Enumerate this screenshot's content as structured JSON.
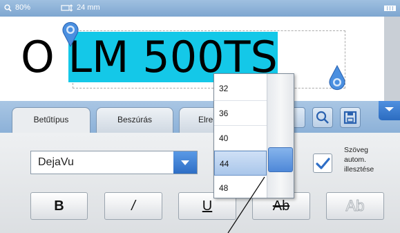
{
  "status": {
    "zoom": "80%",
    "tape_width": "24 mm"
  },
  "label": {
    "text_before": "O ",
    "text_selected": "LM 500TS"
  },
  "tabs": [
    {
      "label": "Betűtípus"
    },
    {
      "label": "Beszúrás"
    },
    {
      "label": "Elre"
    }
  ],
  "font": {
    "selected": "DejaVu"
  },
  "size_options": [
    "32",
    "36",
    "40",
    "44",
    "48"
  ],
  "size_selected": "44",
  "autofit": {
    "checked": true,
    "line1": "Szöveg",
    "line2": "autom.",
    "line3": "illesztése"
  },
  "format_buttons": {
    "bold": "B",
    "italic": "/",
    "underline": "U",
    "strike": "Ab",
    "outline": "Ab"
  },
  "colors": {
    "accent": "#14c8e8",
    "toolbar": "#8cb1d8",
    "button_blue": "#2e6ec6"
  }
}
